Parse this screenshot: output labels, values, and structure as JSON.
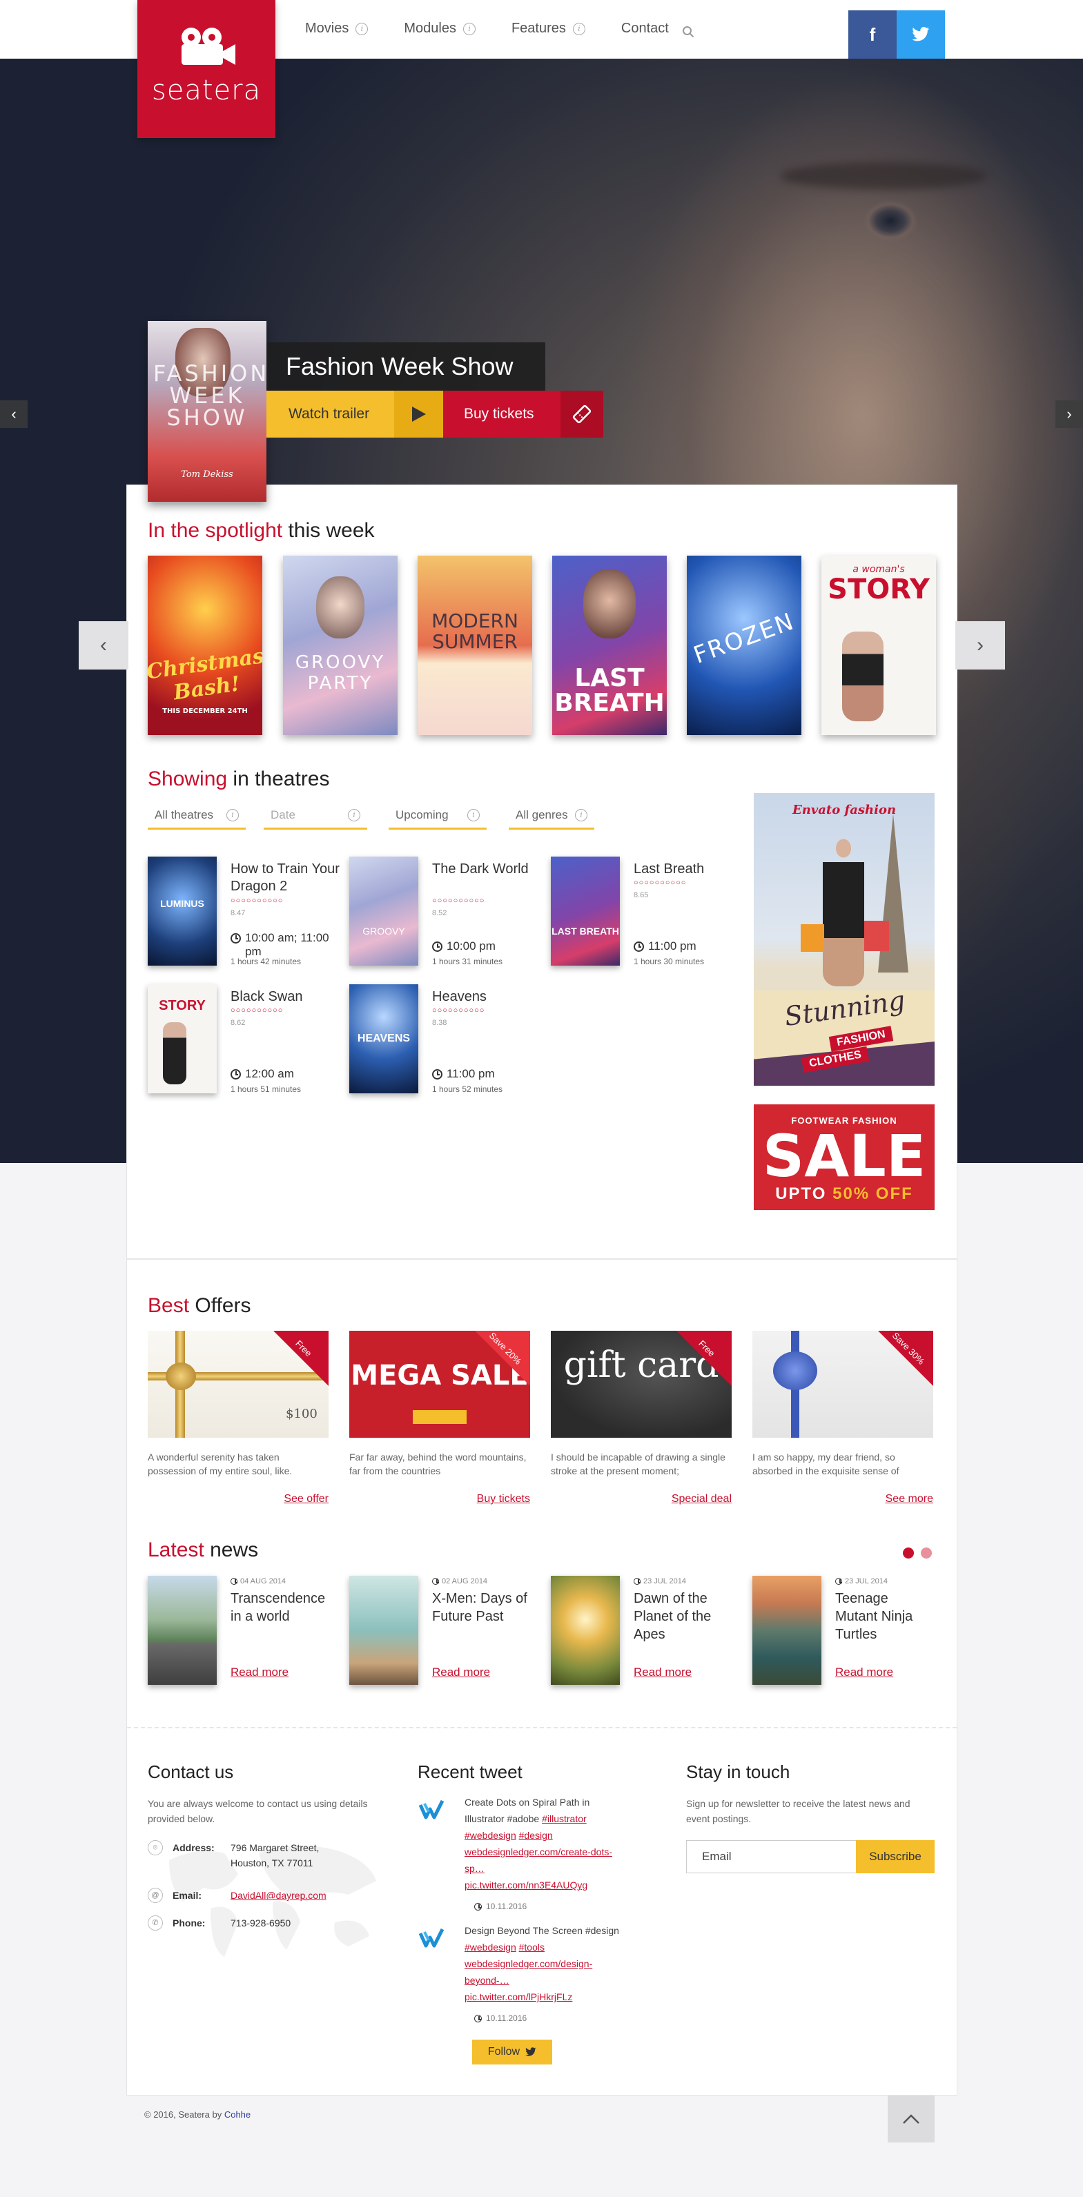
{
  "logo": {
    "text": "seatera"
  },
  "nav": {
    "items": [
      {
        "label": "Movies"
      },
      {
        "label": "Modules"
      },
      {
        "label": "Features"
      },
      {
        "label": "Contact"
      }
    ]
  },
  "social": {
    "facebook": "f",
    "twitter": "t"
  },
  "hero": {
    "poster_text": "FASHION WEEK SHOW",
    "poster_caption": "Tom Dekiss",
    "title": "Fashion Week Show",
    "watch_trailer": "Watch trailer",
    "buy_tickets": "Buy tickets"
  },
  "spotlight": {
    "title_highlight": "In the spotlight",
    "title_rest": " this week",
    "posters": [
      {
        "text": "Christmas Bash!",
        "sub": "THIS DECEMBER 24TH"
      },
      {
        "text": "GROOVY PARTY",
        "sub": ""
      },
      {
        "text": "MODERN SUMMER",
        "sub": ""
      },
      {
        "text": "LAST BREATH",
        "sub": ""
      },
      {
        "text": "FROZEN",
        "sub": ""
      },
      {
        "text": "STORY",
        "sub": "a woman's"
      }
    ]
  },
  "showing": {
    "title_highlight": "Showing",
    "title_rest": " in theatres",
    "filters": [
      "All theatres",
      "Date",
      "Upcoming",
      "All genres"
    ],
    "movies": [
      {
        "title": "How to Train Your Dragon 2",
        "rating": "8.47",
        "time": "10:00 am; 11:00 pm",
        "duration": "1 hours 42 minutes",
        "poster": "LUMINUS"
      },
      {
        "title": "The Dark World",
        "rating": "8.52",
        "time": "10:00 pm",
        "duration": "1 hours 31 minutes",
        "poster": "GROOVY"
      },
      {
        "title": "Last Breath",
        "rating": "8.65",
        "time": "11:00 pm",
        "duration": "1 hours 30 minutes",
        "poster": "LAST BREATH"
      },
      {
        "title": "Black Swan",
        "rating": "8.62",
        "time": "12:00 am",
        "duration": "1 hours 51 minutes",
        "poster": "STORY"
      },
      {
        "title": "Heavens",
        "rating": "8.38",
        "time": "11:00 pm",
        "duration": "1 hours 52 minutes",
        "poster": "HEAVENS"
      }
    ]
  },
  "ads": {
    "fashion_brand": "Envato fashion",
    "fashion_big": "Stunning",
    "fashion_tag1": "FASHION",
    "fashion_tag2": "CLOTHES",
    "sale_top": "FOOTWEAR FASHION",
    "sale_big": "SALE",
    "sale_bottom": "UPTO",
    "sale_percent": "50% OFF"
  },
  "offers": {
    "title_highlight": "Best",
    "title_rest": " Offers",
    "items": [
      {
        "ribbon": "Free",
        "desc": "A wonderful serenity has taken possession of my entire soul, like.",
        "link": "See offer",
        "img_text": "$100"
      },
      {
        "ribbon": "Save 20%",
        "desc": "Far far away, behind the word mountains, far from the countries",
        "link": "Buy tickets",
        "img_text": "MEGA SALE"
      },
      {
        "ribbon": "Free",
        "desc": "I should be incapable of drawing a single stroke at the present moment;",
        "link": "Special deal",
        "img_text": "gift card"
      },
      {
        "ribbon": "Save 30%",
        "desc": "I am so happy, my dear friend, so absorbed in the exquisite sense of",
        "link": "See more",
        "img_text": ""
      }
    ]
  },
  "news": {
    "title_highlight": "Latest",
    "title_rest": " news",
    "items": [
      {
        "date": "04 AUG 2014",
        "title": "Transcendence in a world",
        "more": "Read more"
      },
      {
        "date": "02 AUG 2014",
        "title": "X-Men: Days of Future Past",
        "more": "Read more"
      },
      {
        "date": "23 JUL 2014",
        "title": "Dawn of the Planet of the Apes",
        "more": "Read more"
      },
      {
        "date": "23 JUL 2014",
        "title": "Teenage Mutant Ninja Turtles",
        "more": "Read more"
      }
    ]
  },
  "contact": {
    "title": "Contact us",
    "intro": "You are always welcome to contact us using details provided below.",
    "address_label": "Address:",
    "address": "796 Margaret Street, Houston, TX 77011",
    "email_label": "Email:",
    "email": "DavidAll@dayrep.com",
    "phone_label": "Phone:",
    "phone": "713-928-6950"
  },
  "tweets": {
    "title": "Recent tweet",
    "items": [
      {
        "pre": "Create Dots on Spiral Path in Illustrator #adobe ",
        "tag1": "#illustrator",
        "tag2": "#webdesign",
        "tag3": "#design",
        "link1": "webdesignledger.com/create-dots-sp…",
        "link2": "pic.twitter.com/nn3E4AUQyg",
        "date": "10.11.2016"
      },
      {
        "pre": "Design Beyond The Screen #design ",
        "tag1": "#webdesign",
        "tag2": "#tools",
        "link1": "webdesignledger.com/design-beyond-…",
        "link2": "pic.twitter.com/lPjHkrjFLz",
        "date": "10.11.2016"
      }
    ],
    "follow": "Follow"
  },
  "newsletter": {
    "title": "Stay in touch",
    "text": "Sign up for newsletter to receive the latest news and event postings.",
    "placeholder": "Email",
    "subscribe": "Subscribe"
  },
  "footer": {
    "copyright": "© 2016, Seatera by ",
    "brand": "Cohhe"
  }
}
